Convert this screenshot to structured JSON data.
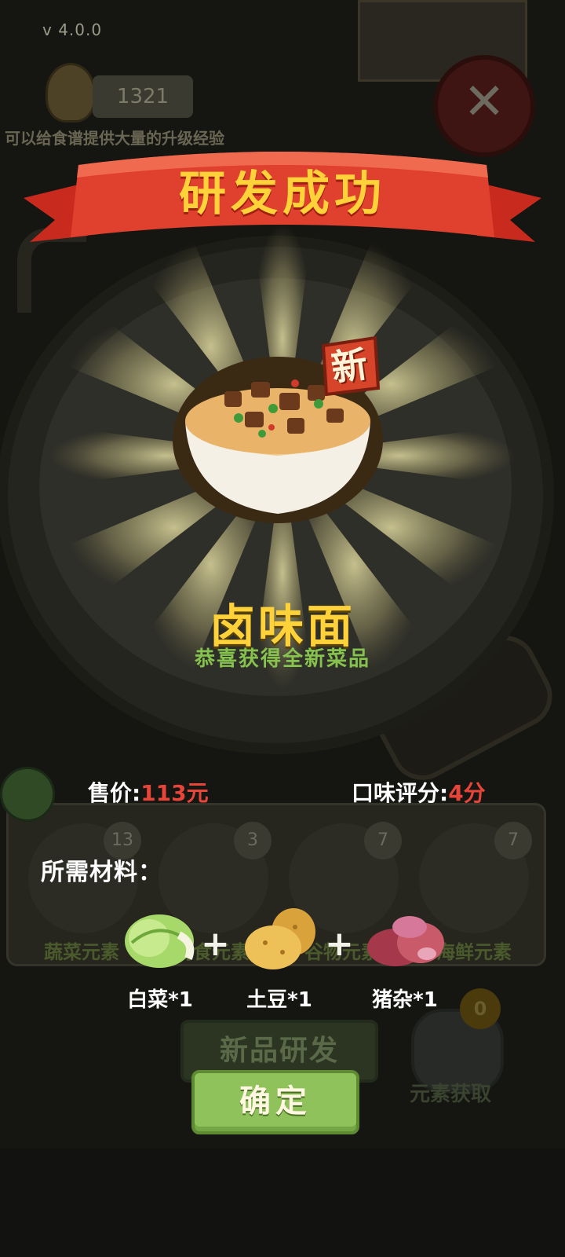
{
  "background": {
    "version": "v  4.0.0",
    "counter": "1321",
    "hint": "可以给食谱提供大量的升级经验",
    "elements": [
      {
        "label": "蔬菜元素",
        "count": "13",
        "color": "#3a5a22"
      },
      {
        "label": "肉食元素",
        "count": "3",
        "color": "#5a2020"
      },
      {
        "label": "谷物元素",
        "count": "7",
        "color": "#5a4a18"
      },
      {
        "label": "海鲜元素",
        "count": "7",
        "color": "#1c3a55"
      }
    ],
    "research_button": "新品研发",
    "element_fetch_label": "元素获取",
    "element_fetch_count": "0"
  },
  "modal": {
    "title": "研发成功",
    "new_badge": "新",
    "dish_name": "卤味面",
    "dish_subtitle": "恭喜获得全新菜品",
    "price_label": "售价:",
    "price_value": "113元",
    "rating_label": "口味评分:",
    "rating_value": "4分",
    "materials_title": "所需材料：",
    "ingredients": [
      {
        "label": "白菜*1",
        "icon": "cabbage-icon"
      },
      {
        "label": "土豆*1",
        "icon": "potato-icon"
      },
      {
        "label": "猪杂*1",
        "icon": "pork-offal-icon"
      }
    ],
    "confirm_button": "确定"
  },
  "colors": {
    "title_yellow": "#ffd23a",
    "ribbon_red": "#e0402e",
    "subtitle_green": "#86c24e",
    "value_red": "#e8453a",
    "button_green": "#8fc25a"
  }
}
